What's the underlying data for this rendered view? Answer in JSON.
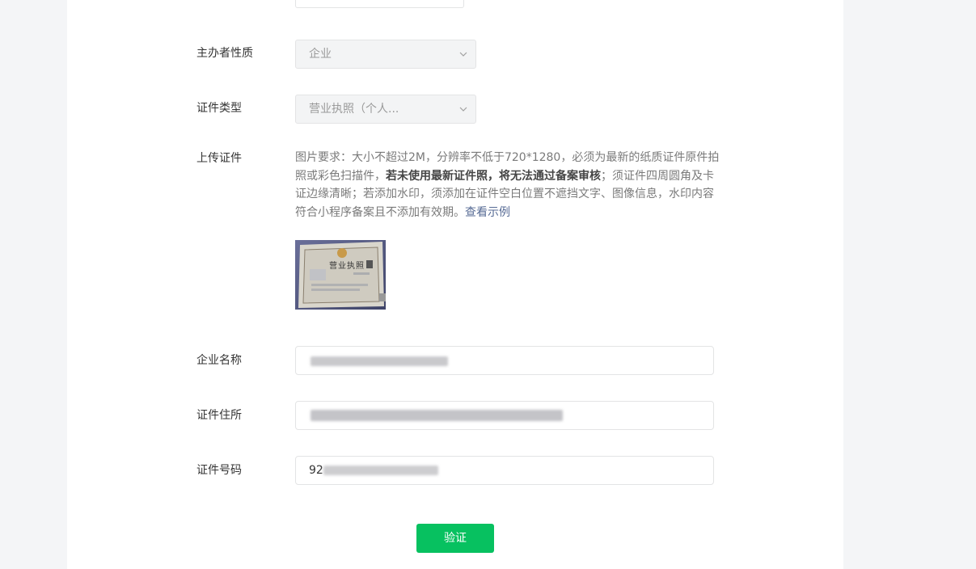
{
  "form": {
    "organizer_nature": {
      "label": "主办者性质",
      "value": "企业"
    },
    "certificate_type": {
      "label": "证件类型",
      "value": "营业执照（个人..."
    },
    "upload_certificate": {
      "label": "上传证件",
      "requirement_prefix": "图片要求：大小不超过2M，分辨率不低于720*1280，必须为最新的纸质证件原件拍照或彩色扫描件，",
      "requirement_bold": "若未使用最新证件照，将无法通过备案审核",
      "requirement_suffix": "；须证件四周圆角及卡证边缘清晰；若添加水印，须添加在证件空白位置不遮挡文字、图像信息，水印内容符合小程序备案且不添加有效期。",
      "view_example_link": "查看示例",
      "thumbnail_text": "营业执照"
    },
    "company_name": {
      "label": "企业名称"
    },
    "certificate_address": {
      "label": "证件住所"
    },
    "certificate_number": {
      "label": "证件号码",
      "value_visible_prefix": "92"
    },
    "verify_button": "验证"
  },
  "colors": {
    "primary_green": "#07c160",
    "link_blue": "#576b95",
    "page_background": "#f4f5f7"
  }
}
